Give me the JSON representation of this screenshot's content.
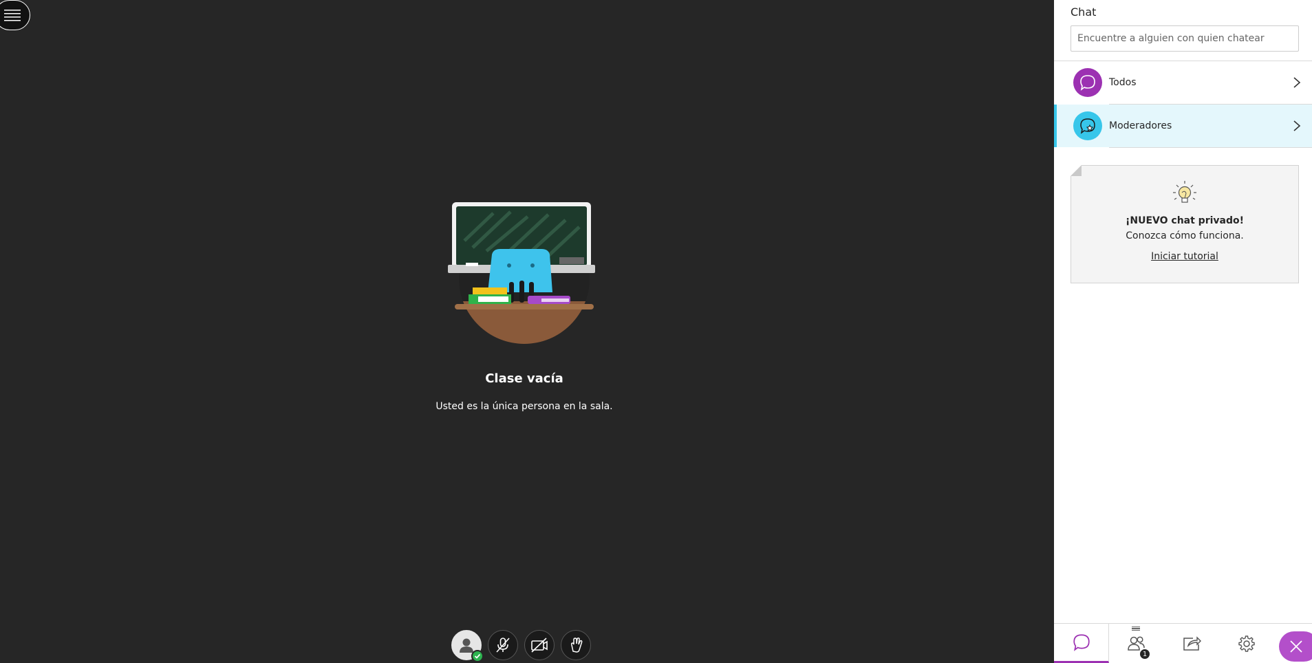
{
  "menu": {
    "icon": "hamburger-icon"
  },
  "stage": {
    "empty_title": "Clase vacía",
    "empty_subtitle": "Usted es la única persona en la sala."
  },
  "controls": [
    {
      "name": "avatar",
      "icon": "user-icon"
    },
    {
      "name": "microphone",
      "icon": "mic-off-icon"
    },
    {
      "name": "camera",
      "icon": "camera-off-icon"
    },
    {
      "name": "raise-hand",
      "icon": "hand-icon"
    }
  ],
  "panel": {
    "title": "Chat",
    "search_placeholder": "Encuentre a alguien con quien chatear",
    "chats": [
      {
        "label": "Todos",
        "color": "#9c31b2"
      },
      {
        "label": "Moderadores",
        "color": "#37c6ea"
      }
    ],
    "tip": {
      "title": "¡NUEVO chat privado!",
      "text": "Conozca cómo funciona.",
      "link": "Iniciar tutorial"
    },
    "tabs": [
      {
        "name": "chat",
        "icon": "chat-icon",
        "active": true
      },
      {
        "name": "attendees",
        "icon": "attendees-icon",
        "badge": "1"
      },
      {
        "name": "share",
        "icon": "share-icon"
      },
      {
        "name": "settings",
        "icon": "gear-icon"
      }
    ]
  },
  "colors": {
    "accent": "#9c31b2",
    "highlight": "#37c6ea",
    "stage_bg": "#262626"
  }
}
